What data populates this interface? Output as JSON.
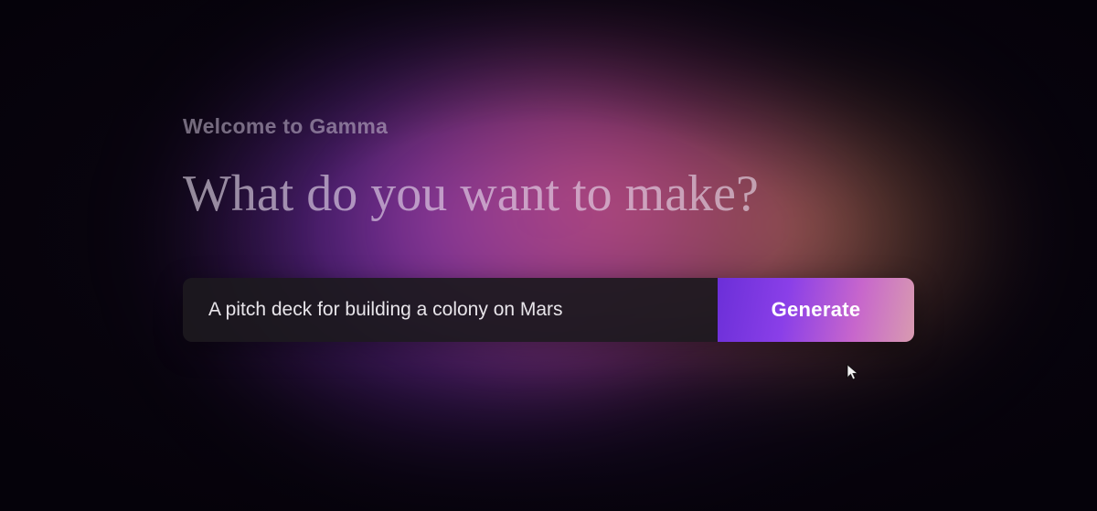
{
  "hero": {
    "welcome": "Welcome to Gamma",
    "headline": "What do you want to make?"
  },
  "input": {
    "value": "A pitch deck for building a colony on Mars",
    "placeholder": ""
  },
  "button": {
    "generate_label": "Generate"
  },
  "colors": {
    "accent_purple": "#8a3fe8",
    "accent_pink": "#e85f8c",
    "accent_orange": "#f09664",
    "bg_dark": "#0a0510"
  }
}
